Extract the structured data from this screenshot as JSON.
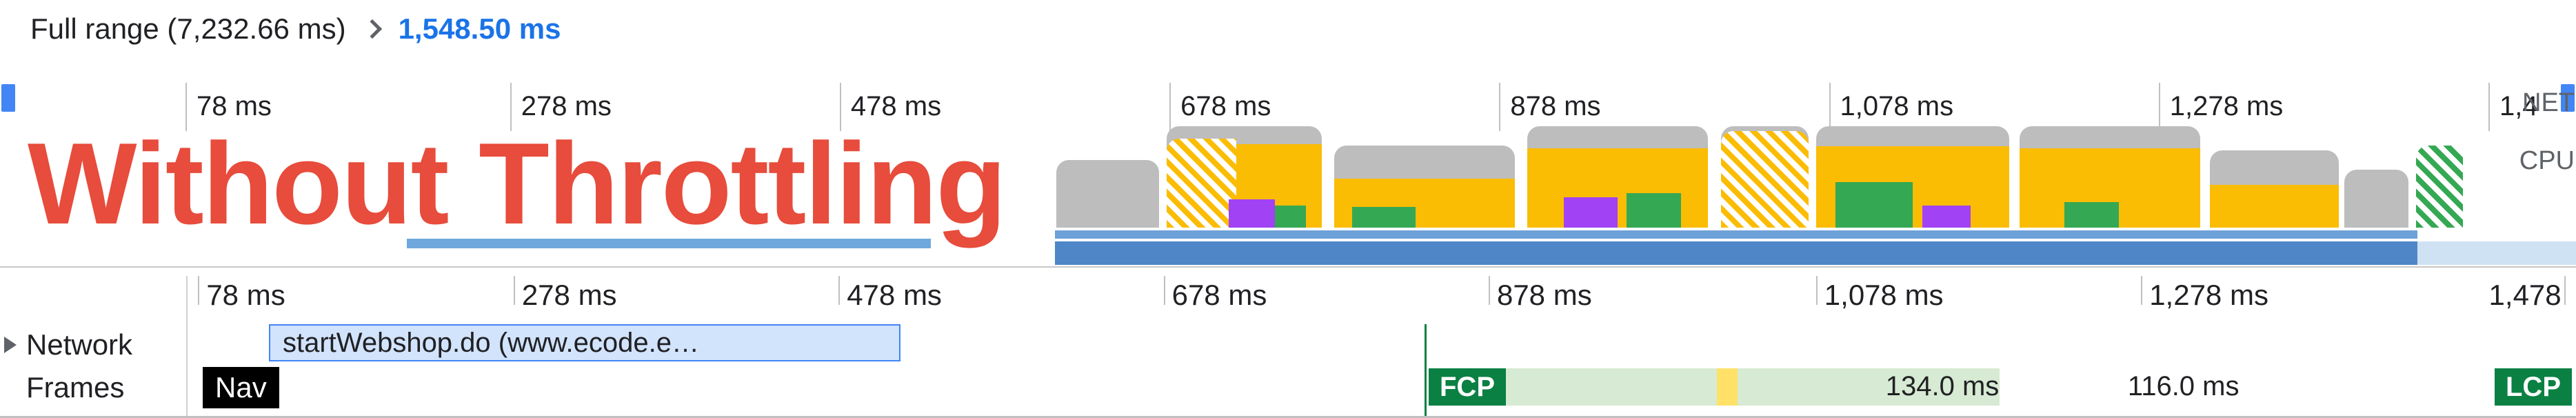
{
  "breadcrumb": {
    "full_range_label": "Full range (7,232.66 ms)",
    "selected_range": "1,548.50 ms"
  },
  "overlay_text": "Without Throttling",
  "overview": {
    "ruler_ticks": [
      {
        "label": "78 ms",
        "pos_pct": 7.2
      },
      {
        "label": "278 ms",
        "pos_pct": 19.8
      },
      {
        "label": "478 ms",
        "pos_pct": 32.6
      },
      {
        "label": "678 ms",
        "pos_pct": 45.4
      },
      {
        "label": "878 ms",
        "pos_pct": 58.2
      },
      {
        "label": "1,078 ms",
        "pos_pct": 71.0
      },
      {
        "label": "1,278 ms",
        "pos_pct": 83.8
      },
      {
        "label": "1,4",
        "pos_pct": 96.6
      }
    ],
    "cpu_label": "CPU",
    "net_label": "NET"
  },
  "detail": {
    "ruler_ticks": [
      {
        "label": "78 ms",
        "pos_pct": 0.5
      },
      {
        "label": "278 ms",
        "pos_pct": 13.7
      },
      {
        "label": "478 ms",
        "pos_pct": 27.3
      },
      {
        "label": "678 ms",
        "pos_pct": 40.9
      },
      {
        "label": "878 ms",
        "pos_pct": 54.5
      },
      {
        "label": "1,078 ms",
        "pos_pct": 68.2
      },
      {
        "label": "1,278 ms",
        "pos_pct": 81.8
      },
      {
        "label": "1,478",
        "pos_pct": 99.5,
        "last": true
      }
    ],
    "network_row_label": "Network",
    "network_request_label": "startWebshop.do (www.ecode.e…",
    "frames_row_label": "Frames",
    "nav_badge": "Nav",
    "fcp_badge": "FCP",
    "lcp_badge": "LCP",
    "fcp_pos_pct": 55.3,
    "frame_times": [
      {
        "text": "134.0 ms",
        "pos_pct": 73.2
      },
      {
        "text": "116.0 ms",
        "pos_pct": 82.6
      }
    ]
  }
}
